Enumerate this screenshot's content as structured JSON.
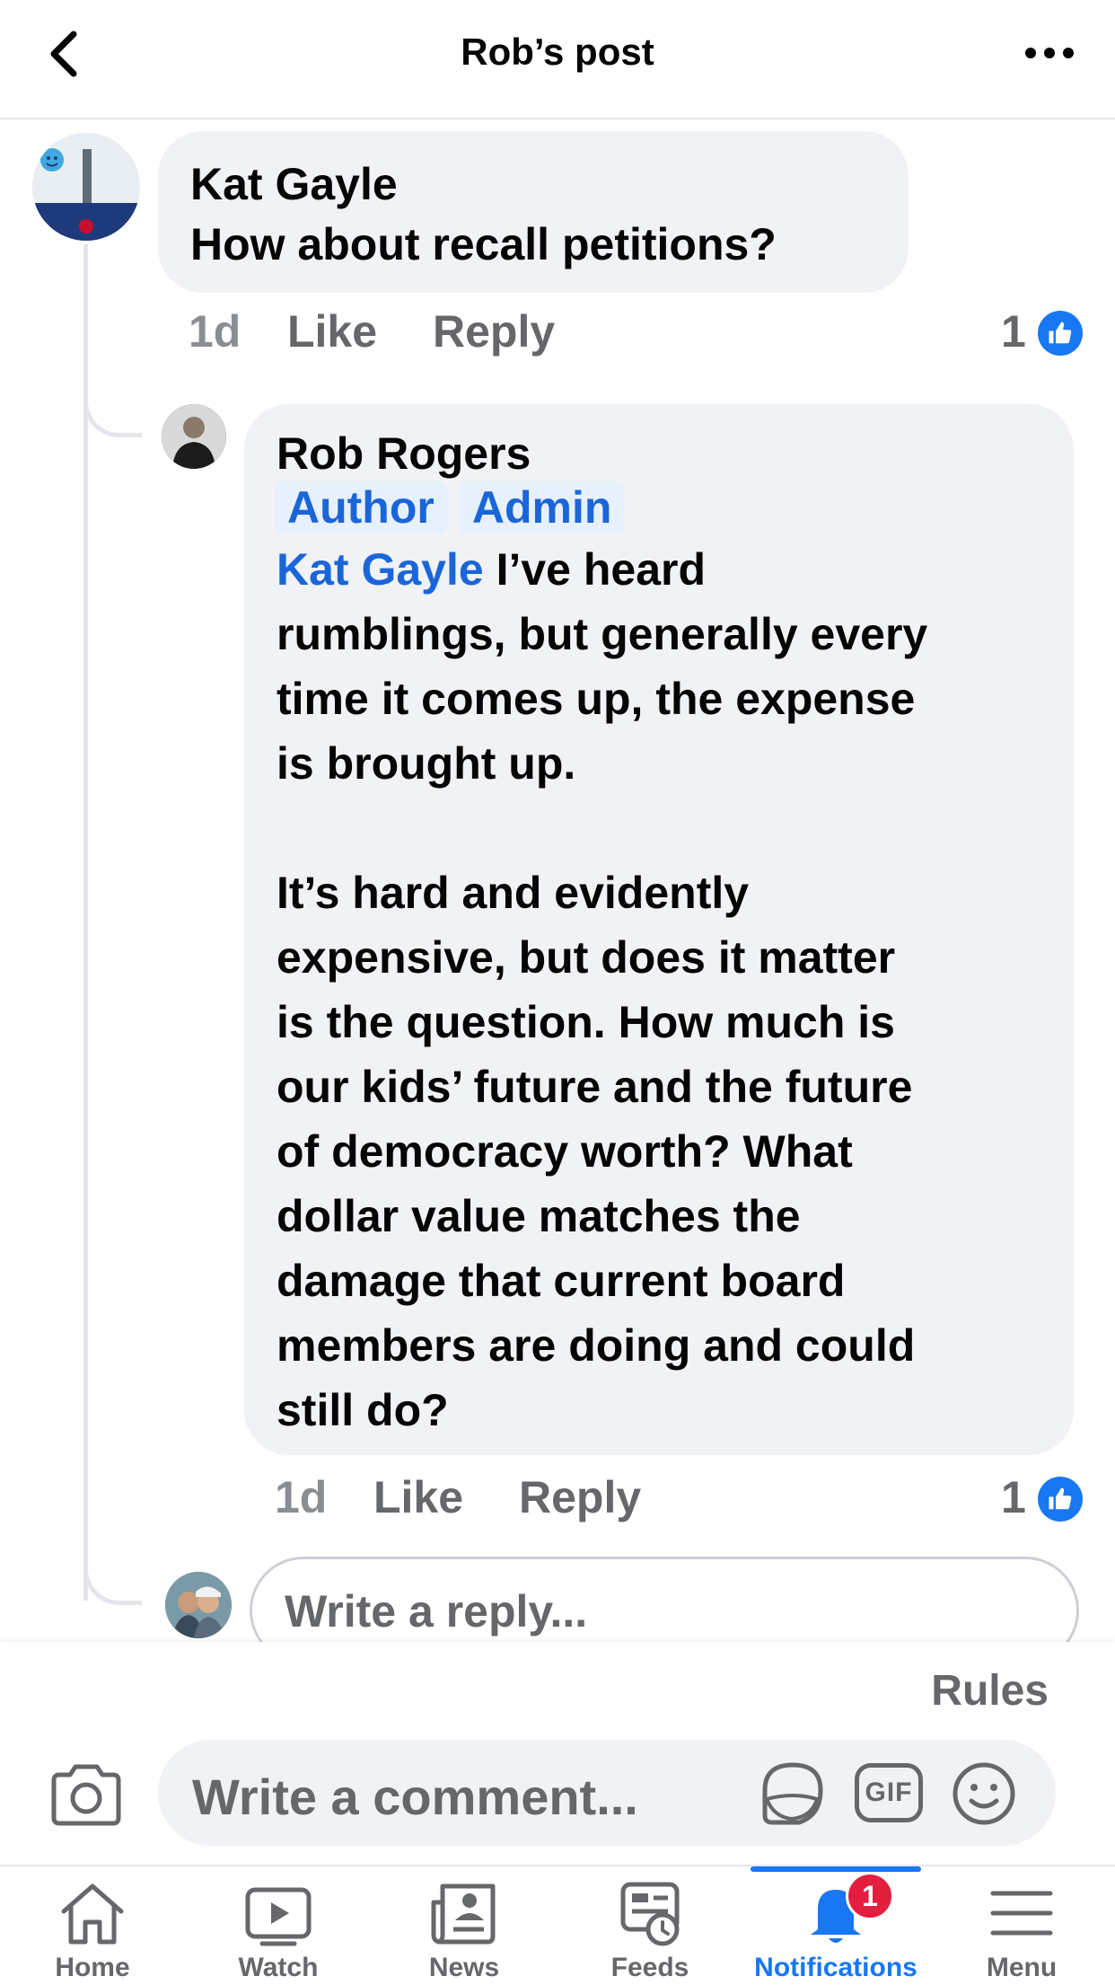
{
  "header": {
    "title": "Rob’s post"
  },
  "comments": [
    {
      "author": "Kat Gayle",
      "text": "How about recall petitions?",
      "time": "1d",
      "like_label": "Like",
      "reply_label": "Reply",
      "like_count": "1"
    }
  ],
  "reply": {
    "author": "Rob Rogers",
    "badges": [
      "Author",
      "Admin"
    ],
    "mention": "Kat Gayle",
    "lines": [
      "I’ve heard",
      "rumblings, but generally every",
      "time it comes up, the expense",
      "is brought up.",
      "",
      "It’s hard and evidently",
      "expensive, but does it matter",
      "is the question. How much is",
      "our kids’ future and the future",
      "of democracy worth? What",
      "dollar value matches the",
      "damage that current board",
      "members are doing and could",
      "still do?"
    ],
    "time": "1d",
    "like_label": "Like",
    "reply_label": "Reply",
    "like_count": "1"
  },
  "reply_input": {
    "placeholder": "Write a reply..."
  },
  "composer": {
    "rules_label": "Rules",
    "placeholder": "Write a comment...",
    "gif_label": "GIF",
    "icons": [
      "camera-icon",
      "sticker-icon",
      "gif-icon",
      "emoji-icon"
    ]
  },
  "tabs": [
    {
      "label": "Home",
      "icon": "home-icon"
    },
    {
      "label": "Watch",
      "icon": "watch-icon"
    },
    {
      "label": "News",
      "icon": "news-icon"
    },
    {
      "label": "Feeds",
      "icon": "feeds-icon"
    },
    {
      "label": "Notifications",
      "icon": "bell-icon",
      "badge": "1",
      "active": true
    },
    {
      "label": "Menu",
      "icon": "menu-icon"
    }
  ],
  "colors": {
    "accent": "#1877f2",
    "bubble": "#f0f2f5",
    "secondary_text": "#65676b",
    "badge_red": "#e41e3f"
  }
}
